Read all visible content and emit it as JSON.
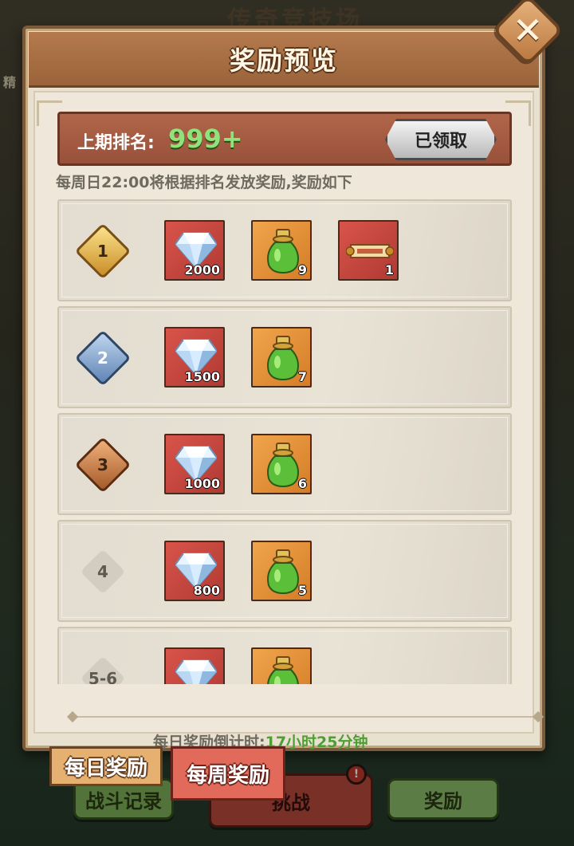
{
  "background": {
    "title": "传奇竞技场",
    "left_label": "精",
    "battle_record_label": "战斗记录",
    "challenge_label": "挑战",
    "reward_label": "奖励",
    "alert_badge": "!"
  },
  "dialog": {
    "title": "奖励预览",
    "close_icon": "close-icon",
    "last_rank_label": "上期排名:",
    "last_rank_value": "999+",
    "claimed_label": "已领取",
    "notice": "每周日22:00将根据排名发放奖励,奖励如下",
    "countdown_label": "每日奖励倒计时:",
    "countdown_value": "17小时25分钟"
  },
  "tabs": {
    "daily": "每日奖励",
    "weekly": "每周奖励"
  },
  "reward_rows": [
    {
      "rank": "1",
      "badge": "gold",
      "items": [
        {
          "icon": "diamond-icon",
          "count": "2000",
          "bg": "red"
        },
        {
          "icon": "potion-icon",
          "count": "9",
          "bg": "orange"
        },
        {
          "icon": "scroll-icon",
          "count": "1",
          "bg": "red"
        }
      ]
    },
    {
      "rank": "2",
      "badge": "silver",
      "items": [
        {
          "icon": "diamond-icon",
          "count": "1500",
          "bg": "red"
        },
        {
          "icon": "potion-icon",
          "count": "7",
          "bg": "orange"
        }
      ]
    },
    {
      "rank": "3",
      "badge": "bronze",
      "items": [
        {
          "icon": "diamond-icon",
          "count": "1000",
          "bg": "red"
        },
        {
          "icon": "potion-icon",
          "count": "6",
          "bg": "orange"
        }
      ]
    },
    {
      "rank": "4",
      "badge": "plain",
      "items": [
        {
          "icon": "diamond-icon",
          "count": "800",
          "bg": "red"
        },
        {
          "icon": "potion-icon",
          "count": "5",
          "bg": "orange"
        }
      ]
    },
    {
      "rank": "5-6",
      "badge": "plain",
      "items": [
        {
          "icon": "diamond-icon",
          "count": "",
          "bg": "red"
        },
        {
          "icon": "potion-icon",
          "count": "",
          "bg": "orange"
        }
      ]
    }
  ]
}
